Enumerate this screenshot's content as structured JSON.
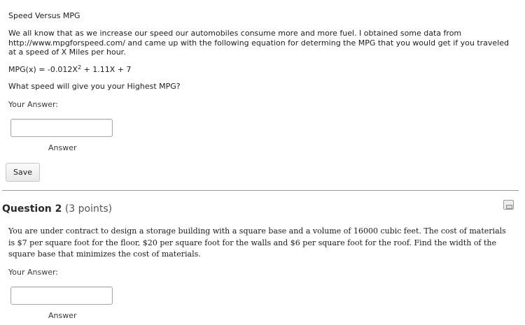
{
  "question1": {
    "title": "Speed Versus MPG",
    "intro": "We all know that as we increase our speed our automobiles consume more and more fuel. I obtained some data from http://www.mpgforspeed.com/ and came up with the following equation for determing the MPG that you would get if you traveled at a speed of X Miles per hour.",
    "equation": {
      "before": "MPG(x) = -0.012X",
      "exponent": "2",
      "after": " + 1.11X + 7"
    },
    "prompt": "What speed will give you your Highest MPG?",
    "your_answer_label": "Your Answer:",
    "answer_value": "",
    "answer_caption": "Answer",
    "save_label": "Save"
  },
  "question2": {
    "label": "Question 2",
    "points": "(3 points)",
    "text": "You are under contract to design a storage building with a square base and a volume of 16000 cubic feet.  The cost of materials is $7 per square foot for the floor, $20 per square foot for the walls and $6 per square foot for the roof.  Find the width of the square base that minimizes the cost of materials.",
    "your_answer_label": "Your Answer:",
    "answer_value": "",
    "answer_caption": "Answer",
    "flag_icon": "save-flag-icon"
  }
}
